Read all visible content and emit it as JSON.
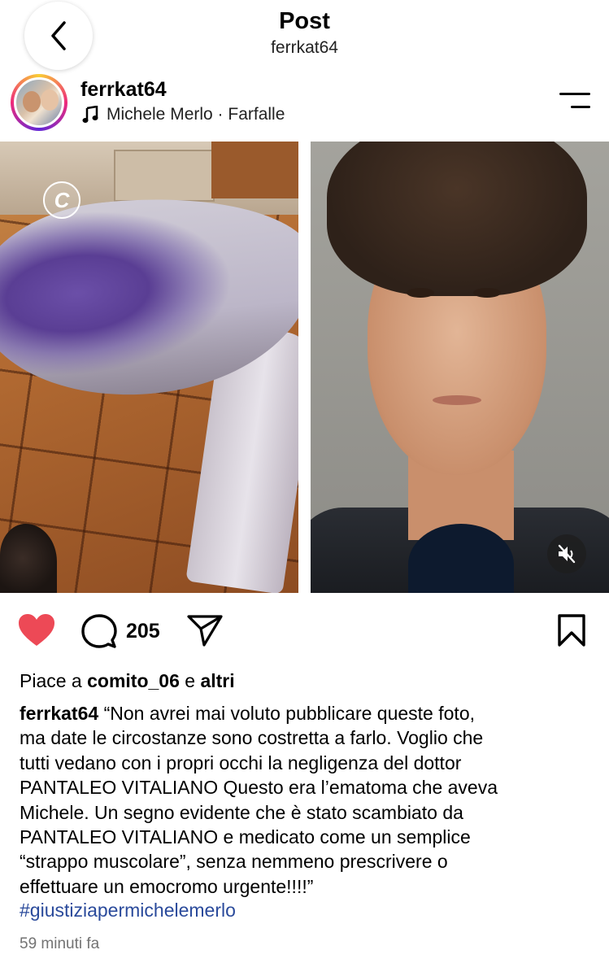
{
  "header": {
    "title": "Post",
    "subtitle": "ferrkat64",
    "back_icon": "chevron-left-icon"
  },
  "author": {
    "username": "ferrkat64",
    "music": "Michele Merlo · Farfalle",
    "music_icon": "music-note-icon",
    "menu_icon": "menu-icon"
  },
  "media": {
    "left_logo": "C",
    "mute_icon": "speaker-muted-icon"
  },
  "actions": {
    "like_icon": "heart-filled-icon",
    "like_color": "#ed4956",
    "comment_icon": "comment-icon",
    "comment_count": "205",
    "share_icon": "send-icon",
    "save_icon": "bookmark-icon"
  },
  "likes": {
    "prefix": "Piace a",
    "user": "comito_06",
    "connector": "e",
    "others": "altri"
  },
  "caption": {
    "username": "ferrkat64",
    "lines": [
      "“Non avrei mai voluto pubblicare queste foto,",
      "ma date le circostanze sono costretta a farlo. Voglio che",
      "tutti vedano con i propri occhi la negligenza del dottor",
      "PANTALEO VITALIANO Questo era l’ematoma che aveva",
      "Michele. Un segno evidente che è stato scambiato da",
      "PANTALEO VITALIANO e medicato come un semplice",
      "“strappo muscolare”, senza nemmeno prescrivere o",
      "effettuare un emocromo urgente!!!!”"
    ],
    "hashtag": "#giustiziapermichelemerlo",
    "hashtag_color": "#2a4a9b"
  },
  "timestamp": "59 minuti fa"
}
